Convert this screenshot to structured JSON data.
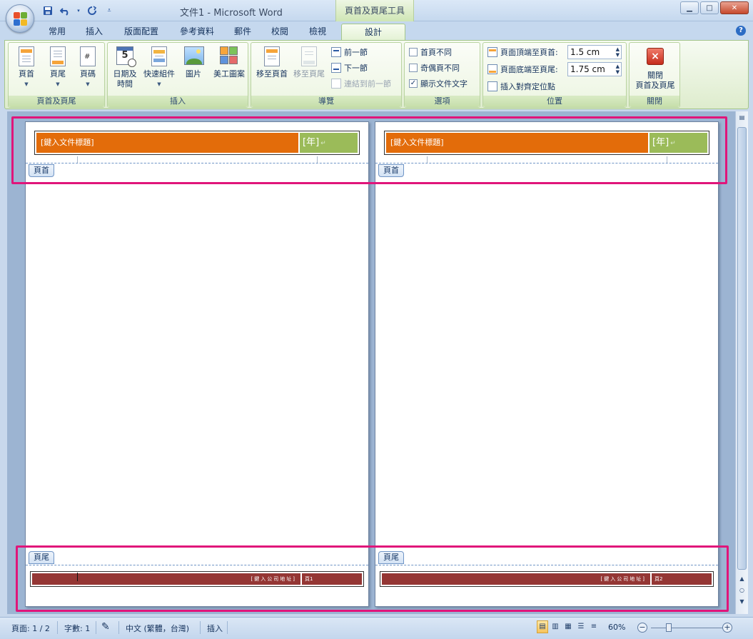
{
  "window": {
    "title": "文件1 - Microsoft Word",
    "context_title": "頁首及頁尾工具",
    "minimize_symbol": "▁",
    "maximize_symbol": "□",
    "close_symbol": "✕"
  },
  "quick_access": {
    "save_icon": "save-icon",
    "undo_icon": "undo-icon",
    "redo_icon": "redo-icon",
    "customize_icon": "customize-icon"
  },
  "tabs": [
    "常用",
    "插入",
    "版面配置",
    "參考資料",
    "郵件",
    "校閱",
    "檢視",
    "設計"
  ],
  "active_tab": "設計",
  "ribbon": {
    "groups": {
      "header_footer": {
        "label": "頁首及頁尾",
        "header": "頁首",
        "footer": "頁尾",
        "page_number": "頁碼"
      },
      "insert": {
        "label": "插入",
        "date_time_1": "日期及",
        "date_time_2": "時間",
        "quick_parts": "快速組件",
        "picture": "圖片",
        "clip_art": "美工圖案",
        "calendar_num": "5"
      },
      "navigation": {
        "label": "導覽",
        "goto_header": "移至頁首",
        "goto_footer": "移至頁尾",
        "prev_section": "前一節",
        "next_section": "下一節",
        "link_prev": "連結到前一節"
      },
      "options": {
        "label": "選項",
        "diff_first": "首頁不同",
        "diff_odd_even": "奇偶頁不同",
        "show_doc_text": "顯示文件文字",
        "diff_first_checked": false,
        "diff_odd_even_checked": false,
        "show_doc_text_checked": true
      },
      "position": {
        "label": "位置",
        "header_from_top": "頁面頂端至頁首:",
        "header_value": "1.5 cm",
        "footer_from_bottom": "頁面底端至頁尾:",
        "footer_value": "1.75 cm",
        "insert_align_tab": "插入對齊定位點"
      },
      "close": {
        "label": "關閉",
        "close_1": "關閉",
        "close_2": "頁首及頁尾"
      }
    }
  },
  "pages": [
    {
      "header_title": "[鍵入文件標題]",
      "header_year": "[年]",
      "header_tag": "頁首",
      "footer_tag": "頁尾",
      "footer_address": "[鍵入公司地址]",
      "footer_page": "頁1"
    },
    {
      "header_title": "[鍵入文件標題]",
      "header_year": "[年]",
      "header_tag": "頁首",
      "footer_tag": "頁尾",
      "footer_address": "[鍵入公司地址]",
      "footer_page": "頁2"
    }
  ],
  "status": {
    "page": "頁面: 1 / 2",
    "words": "字數: 1",
    "language": "中文 (繁體，台灣)",
    "mode": "插入",
    "zoom": "60%"
  },
  "colors": {
    "header_title_bg": "#e36c0a",
    "header_year_bg": "#9bbb59",
    "footer_bg": "#943634",
    "highlight": "#e0157a"
  }
}
